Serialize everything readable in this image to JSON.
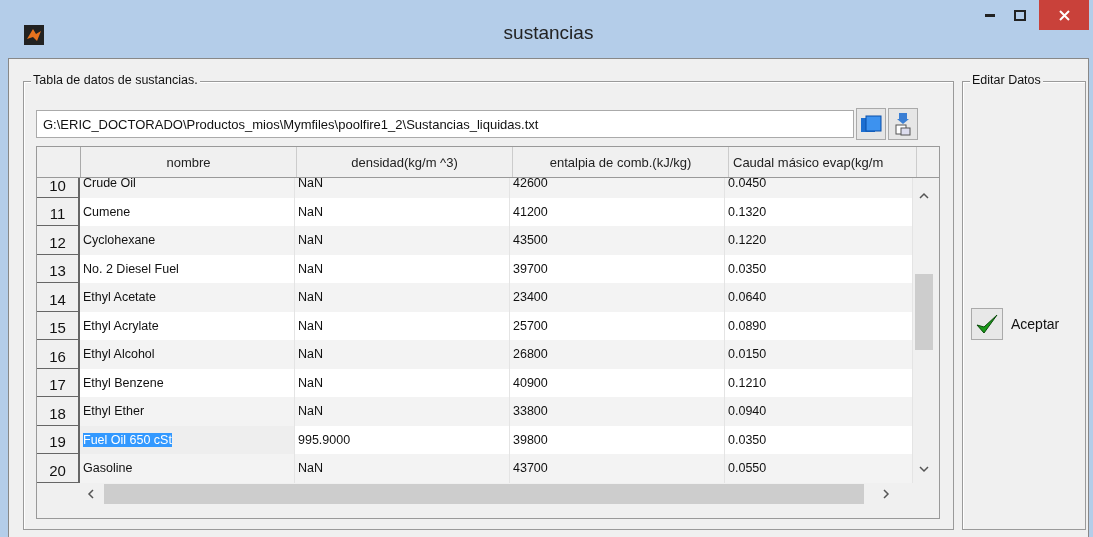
{
  "window": {
    "title": "sustancias"
  },
  "data_panel": {
    "title": "Tabla de datos de sustancias.",
    "path": "G:\\ERIC_DOCTORADO\\Productos_mios\\Mymfiles\\poolfire1_2\\Sustancias_liquidas.txt"
  },
  "table": {
    "columns": [
      "nombre",
      "densidad(kg/m ^3)",
      "entalpia de comb.(kJ/kg)",
      "Caudal másico evap(kg/m"
    ],
    "rows": [
      {
        "index": "10",
        "cells": [
          "Crude Oil",
          "NaN",
          "42600",
          "0.0450"
        ],
        "selected": false
      },
      {
        "index": "11",
        "cells": [
          "Cumene",
          "NaN",
          "41200",
          "0.1320"
        ],
        "selected": false
      },
      {
        "index": "12",
        "cells": [
          "Cyclohexane",
          "NaN",
          "43500",
          "0.1220"
        ],
        "selected": false
      },
      {
        "index": "13",
        "cells": [
          "No. 2 Diesel Fuel",
          "NaN",
          "39700",
          "0.0350"
        ],
        "selected": false
      },
      {
        "index": "14",
        "cells": [
          "Ethyl Acetate",
          "NaN",
          "23400",
          "0.0640"
        ],
        "selected": false
      },
      {
        "index": "15",
        "cells": [
          "Ethyl Acrylate",
          "NaN",
          "25700",
          "0.0890"
        ],
        "selected": false
      },
      {
        "index": "16",
        "cells": [
          "Ethyl Alcohol",
          "NaN",
          "26800",
          "0.0150"
        ],
        "selected": false
      },
      {
        "index": "17",
        "cells": [
          "Ethyl Benzene",
          "NaN",
          "40900",
          "0.1210"
        ],
        "selected": false
      },
      {
        "index": "18",
        "cells": [
          "Ethyl Ether",
          "NaN",
          "33800",
          "0.0940"
        ],
        "selected": false
      },
      {
        "index": "19",
        "cells": [
          "Fuel Oil 650 cSt",
          "995.9000",
          "39800",
          "0.0350"
        ],
        "selected": true
      },
      {
        "index": "20",
        "cells": [
          "Gasoline",
          "NaN",
          "43700",
          "0.0550"
        ],
        "selected": false
      }
    ]
  },
  "edit_panel": {
    "title": "Editar Datos",
    "button": "Aceptar"
  }
}
